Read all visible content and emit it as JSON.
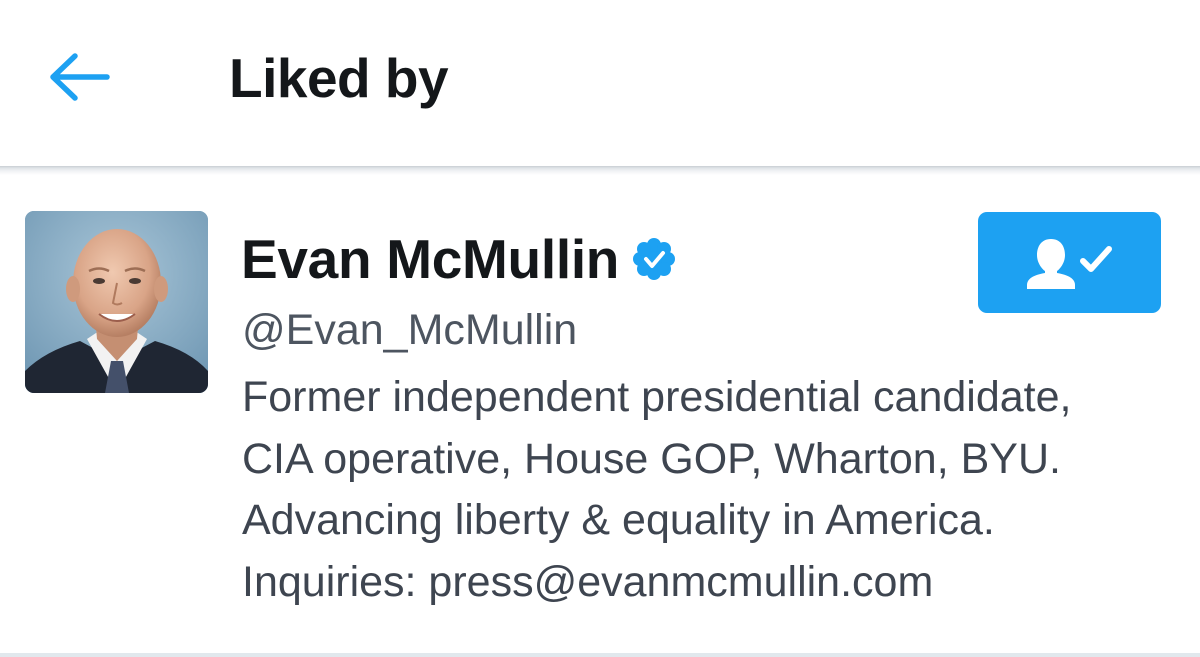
{
  "header": {
    "title": "Liked by",
    "back_icon": "arrow-left-icon",
    "back_color": "#1da1f2"
  },
  "user": {
    "display_name": "Evan McMullin",
    "verified": true,
    "verified_icon": "verified-badge-icon",
    "handle": "@Evan_McMullin",
    "bio_lines": [
      "Former independent presidential candidate,",
      "CIA operative, House GOP, Wharton, BYU.",
      "Advancing liberty & equality in America.",
      "Inquiries: press@evanmcmullin.com"
    ],
    "follow_state": "following",
    "follow_icon": "person-check-icon",
    "accent_color": "#1da1f2"
  }
}
